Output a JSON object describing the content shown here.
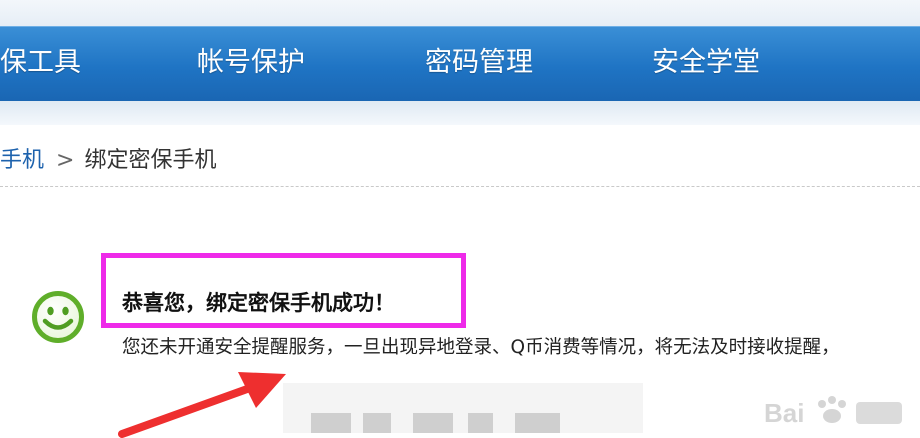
{
  "nav": {
    "items": [
      {
        "label": "保工具"
      },
      {
        "label": "帐号保护"
      },
      {
        "label": "密码管理"
      },
      {
        "label": "安全学堂"
      }
    ],
    "bar_color": "#1f74c4"
  },
  "breadcrumb": {
    "parent": "手机",
    "separator": ">",
    "current": "绑定密保手机"
  },
  "result": {
    "icon": "smiley-face-icon",
    "title": "恭喜您，绑定密保手机成功！",
    "notice": "您还未开通安全提醒服务，一旦出现异地登录、Q币消费等情况，将无法及时接收提醒，"
  },
  "annotation": {
    "highlight_color": "#ee2ae9",
    "arrow_color": "#ee2f2f"
  }
}
